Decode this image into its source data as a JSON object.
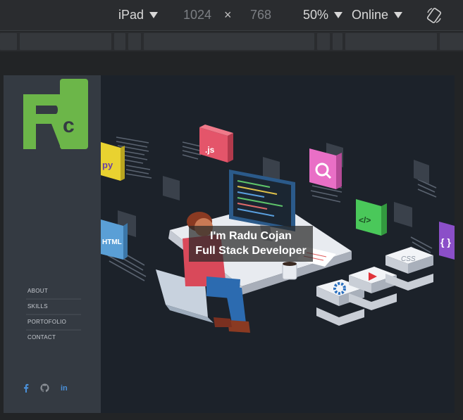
{
  "toolbar": {
    "device": "iPad",
    "width": "1024",
    "times": "×",
    "height": "768",
    "zoom": "50%",
    "network": "Online"
  },
  "site": {
    "nav": [
      "ABOUT",
      "SKILLS",
      "PORTOFOLIO",
      "CONTACT"
    ],
    "hero_line1": "I'm Radu Cojan",
    "hero_line2": "Full Stack Developer",
    "social_linkedin": "in",
    "illustration_labels": {
      "py": "py",
      "js": ".js",
      "html": "HTML",
      "css": "CSS",
      "code": "</>",
      "braces": "{ }"
    }
  },
  "colors": {
    "logo_green": "#6cb649",
    "sidebar": "#343a42",
    "viewport_bg": "#1c222a",
    "social_blue": "#4a90d9"
  }
}
